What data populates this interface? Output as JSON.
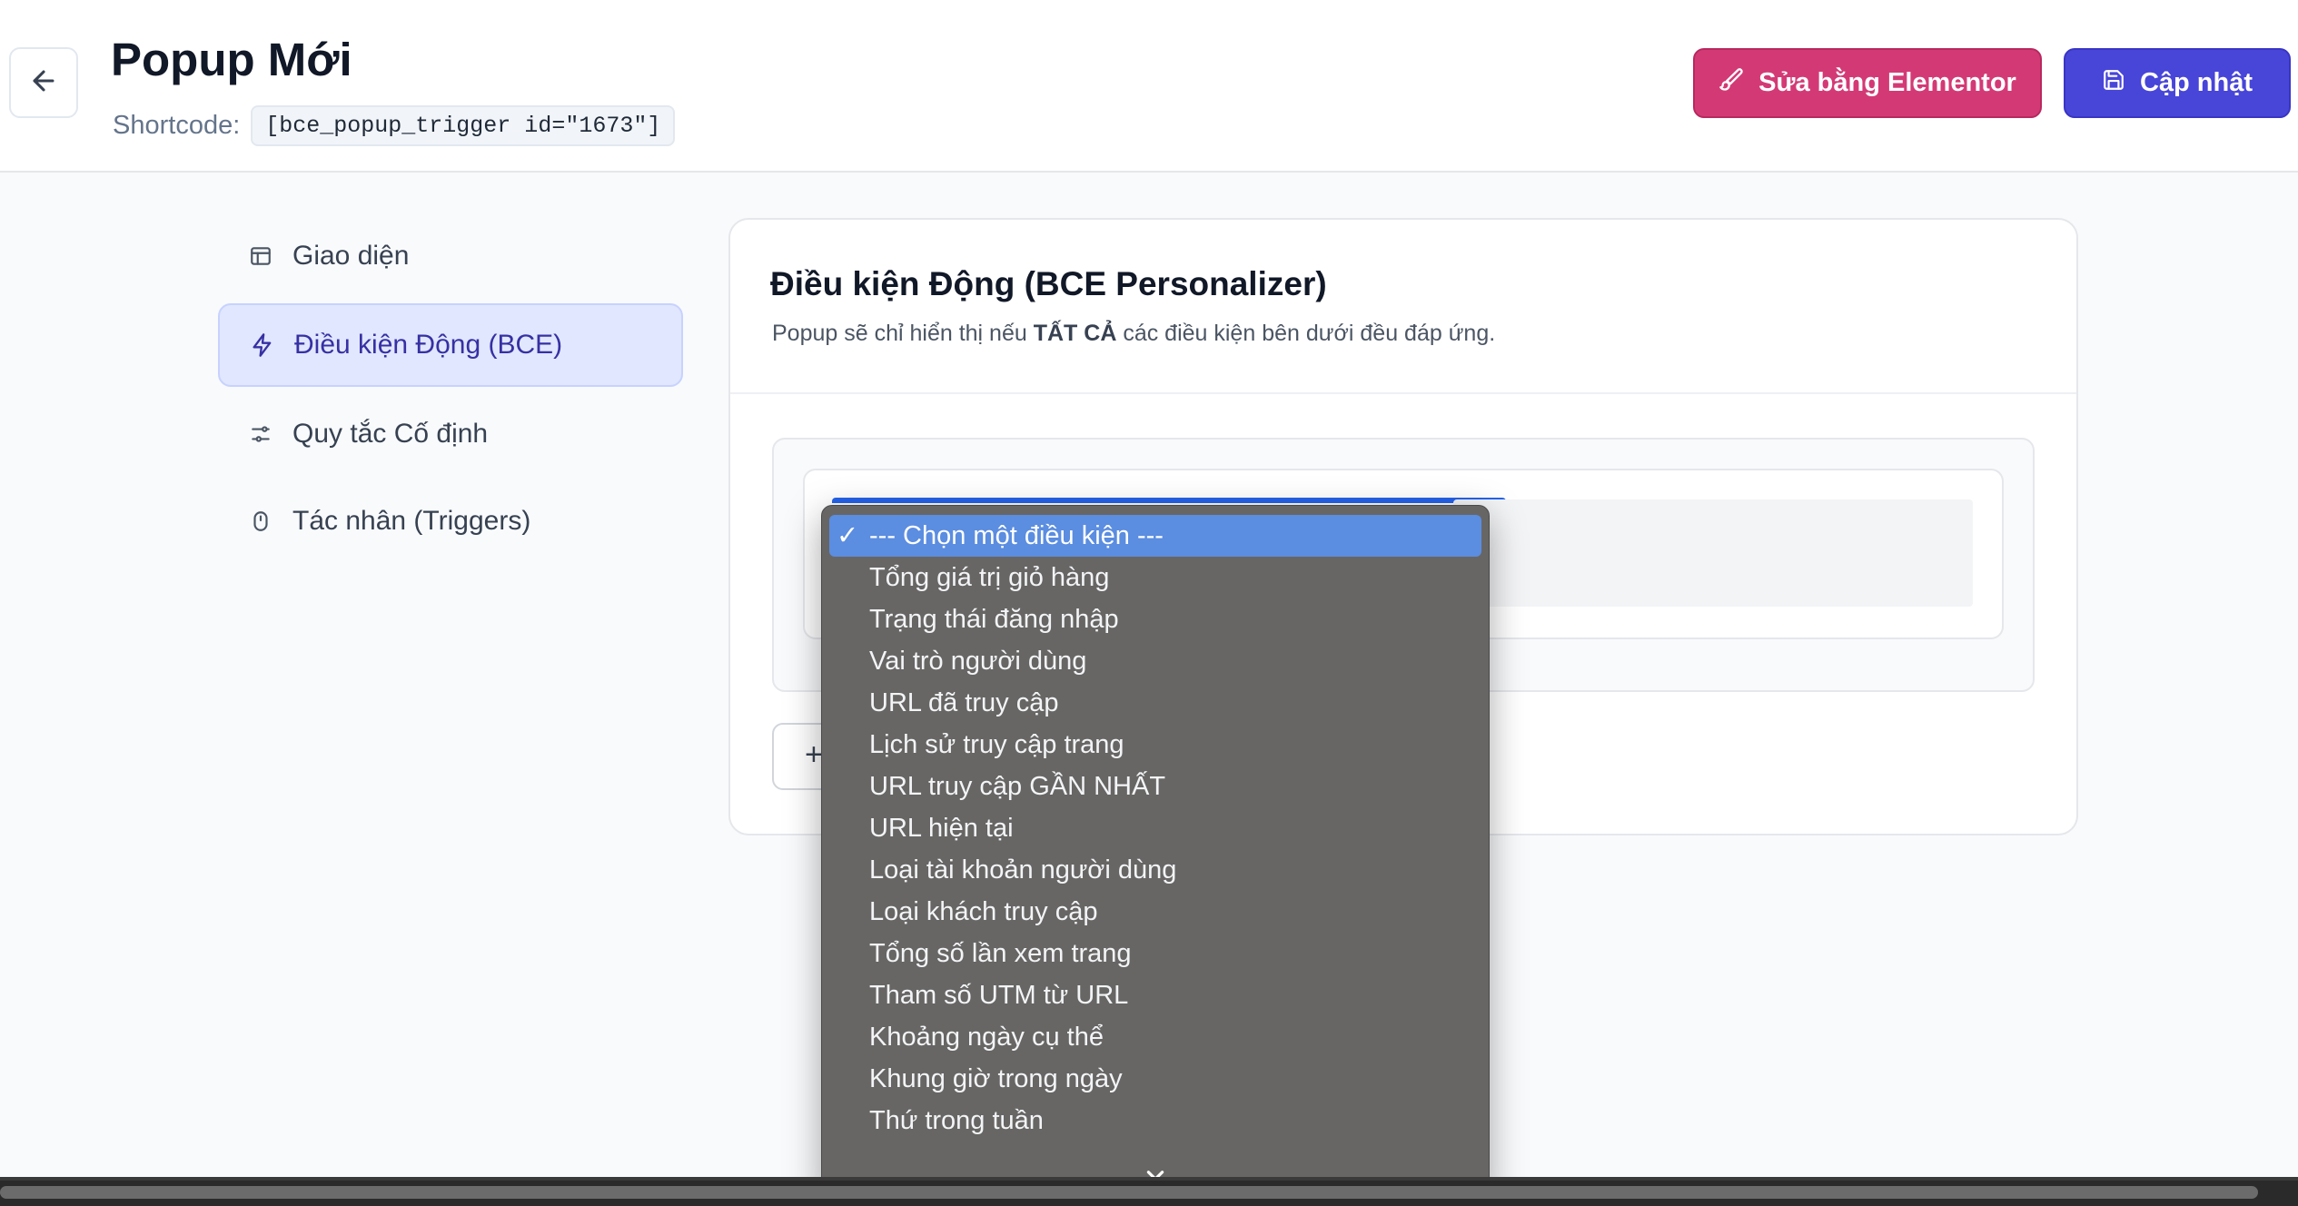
{
  "header": {
    "title": "Popup Mới",
    "shortcode_label": "Shortcode:",
    "shortcode_value": "[bce_popup_trigger id=\"1673\"]",
    "edit_elementor_label": "Sửa bằng Elementor",
    "update_label": "Cập nhật"
  },
  "sidebar": {
    "items": [
      {
        "label": "Giao diện",
        "icon": "layout-icon",
        "active": false
      },
      {
        "label": "Điều kiện Động (BCE)",
        "icon": "zap-icon",
        "active": true
      },
      {
        "label": "Quy tắc Cố định",
        "icon": "sliders-icon",
        "active": false
      },
      {
        "label": "Tác nhân (Triggers)",
        "icon": "mouse-icon",
        "active": false
      }
    ]
  },
  "main": {
    "title": "Điều kiện Động (BCE Personalizer)",
    "desc_before": "Popup sẽ chỉ hiển thị nếu ",
    "desc_emphasis": "TẤT CẢ",
    "desc_after": " các điều kiện bên dưới đều đáp ứng.",
    "add_button_label": "+"
  },
  "dropdown": {
    "selected_check": "✓",
    "options": [
      "--- Chọn một điều kiện ---",
      "Tổng giá trị giỏ hàng",
      "Trạng thái đăng nhập",
      "Vai trò người dùng",
      "URL đã truy cập",
      "Lịch sử truy cập trang",
      "URL truy cập GẦN NHẤT",
      "URL hiện tại",
      "Loại tài khoản người dùng",
      "Loại khách truy cập",
      "Tổng số lần xem trang",
      "Tham số UTM từ URL",
      "Khoảng ngày cụ thể",
      "Khung giờ trong ngày",
      "Thứ trong tuần"
    ]
  },
  "colors": {
    "accent": "#4845d9",
    "elementor": "#d33a75",
    "active_nav_bg": "#e0e7ff",
    "dropdown_bg": "#676665",
    "dropdown_selected": "#5b8de0"
  }
}
